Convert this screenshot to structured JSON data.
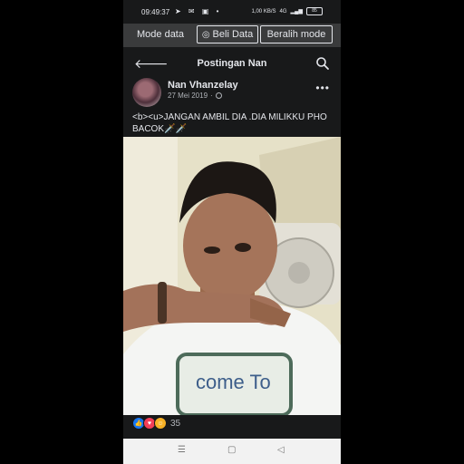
{
  "status_bar": {
    "time": "09:49:37",
    "left_icons": "➤ ✉ ▣ •",
    "net_speed": "1,00 KB/S",
    "network": "4G",
    "battery": "85"
  },
  "data_bar": {
    "mode_label": "Mode data",
    "buy_label": "Beli Data",
    "switch_label": "Beralih mode"
  },
  "header": {
    "title": "Postingan Nan"
  },
  "post": {
    "author": "Nan Vhanzelay",
    "date": "27 Mei 2019",
    "separator": "·",
    "text": "<b><u>JANGAN AMBIL DIA .DIA MILIKKU PHO BACOK🗡️🗡️",
    "reaction_count": "35"
  },
  "icons": {
    "back": "arrow-left",
    "search": "magnifier",
    "more": "ellipsis",
    "globe": "globe",
    "like": "thumb-up",
    "love": "heart",
    "haha": "laugh"
  },
  "colors": {
    "background": "#18191a",
    "bar": "#3a3b3c",
    "text": "#e4e6eb",
    "muted": "#b0b3b8",
    "like": "#1877f2",
    "love": "#f33e58",
    "haha": "#f7b125"
  },
  "photo_text": "come To"
}
